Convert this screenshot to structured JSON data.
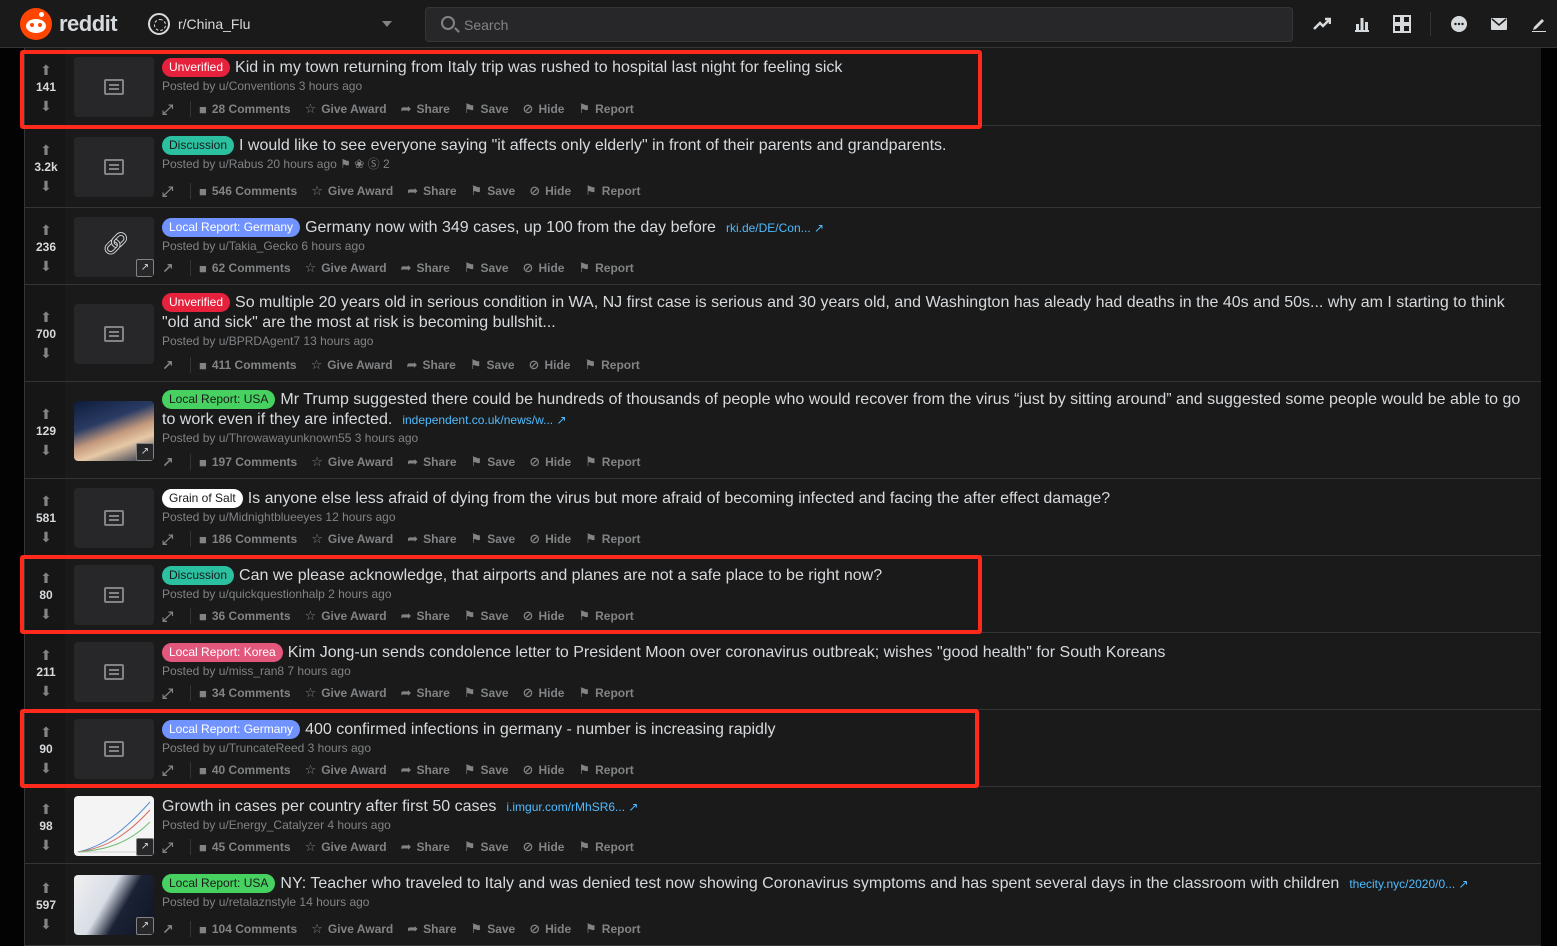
{
  "header": {
    "logo_text": "reddit",
    "community": "r/China_Flu",
    "search_placeholder": "Search",
    "icons": [
      "trending-icon",
      "stats-icon",
      "rpan-icon",
      "chat-icon",
      "mail-icon",
      "create-post-icon"
    ]
  },
  "colors": {
    "highlight": "#ff2a1b",
    "unverified": "#e5213b",
    "discussion": "#2bc0a0",
    "germany": "#7193ff",
    "usa": "#46d160",
    "korea": "#e4577d",
    "salt": "#ffffff"
  },
  "actions": {
    "give_award": "Give Award",
    "share": "Share",
    "save": "Save",
    "hide": "Hide",
    "report": "Report"
  },
  "posts": [
    {
      "score": "141",
      "flair": "Unverified",
      "title": "Kid in my town returning from Italy trip was rushed to hospital last night for feeling sick",
      "domain": "",
      "posted": "Posted by u/Conventions 3 hours ago",
      "comments": "28 Comments"
    },
    {
      "score": "3.2k",
      "flair": "Discussion",
      "title": "I would like to see everyone saying \"it affects only elderly\" in front of their parents and grandparents.",
      "domain": "",
      "posted": "Posted by u/Rabus 20 hours ago",
      "awards": "2",
      "comments": "546 Comments"
    },
    {
      "score": "236",
      "flair": "Local Report: Germany",
      "title": "Germany now with 349 cases, up 100 from the day before",
      "domain": "rki.de/DE/Con...",
      "posted": "Posted by u/Takia_Gecko 6 hours ago",
      "comments": "62 Comments"
    },
    {
      "score": "700",
      "flair": "Unverified",
      "title": "So multiple 20 years old in serious condition in WA, NJ first case is serious and 30 years old, and Washington has aleady had deaths in the 40s and 50s... why am I starting to think \"old and sick\" are the most at risk is becoming bullshit...",
      "domain": "",
      "posted": "Posted by u/BPRDAgent7 13 hours ago",
      "comments": "411 Comments"
    },
    {
      "score": "129",
      "flair": "Local Report: USA",
      "title": "Mr Trump suggested there could be hundreds of thousands of people who would recover from the virus “just by sitting around” and suggested some people would be able to go to work even if they are infected.",
      "domain": "independent.co.uk/news/w...",
      "posted": "Posted by u/Throwawayunknown55 3 hours ago",
      "comments": "197 Comments"
    },
    {
      "score": "581",
      "flair": "Grain of Salt",
      "title": "Is anyone else less afraid of dying from the virus but more afraid of becoming infected and facing the after effect damage?",
      "domain": "",
      "posted": "Posted by u/Midnightblueeyes 12 hours ago",
      "comments": "186 Comments"
    },
    {
      "score": "80",
      "flair": "Discussion",
      "title": "Can we please acknowledge, that airports and planes are not a safe place to be right now?",
      "domain": "",
      "posted": "Posted by u/quickquestionhalp 2 hours ago",
      "comments": "36 Comments"
    },
    {
      "score": "211",
      "flair": "Local Report: Korea",
      "title": "Kim Jong-un sends condolence letter to President Moon over coronavirus outbreak; wishes \"good health\" for South Koreans",
      "domain": "",
      "posted": "Posted by u/miss_ran8 7 hours ago",
      "comments": "34 Comments"
    },
    {
      "score": "90",
      "flair": "Local Report: Germany",
      "title": "400 confirmed infections in germany - number is increasing rapidly",
      "domain": "",
      "posted": "Posted by u/TruncateReed 3 hours ago",
      "comments": "40 Comments"
    },
    {
      "score": "98",
      "flair": "",
      "title": "Growth in cases per country after first 50 cases",
      "domain": "i.imgur.com/rMhSR6...",
      "posted": "Posted by u/Energy_Catalyzer 4 hours ago",
      "comments": "45 Comments"
    },
    {
      "score": "597",
      "flair": "Local Report: USA",
      "title": "NY: Teacher who traveled to Italy and was denied test now showing Coronavirus symptoms and has spent several days in the classroom with children",
      "domain": "thecity.nyc/2020/0...",
      "posted": "Posted by u/retalaznstyle 14 hours ago",
      "comments": "104 Comments"
    }
  ]
}
